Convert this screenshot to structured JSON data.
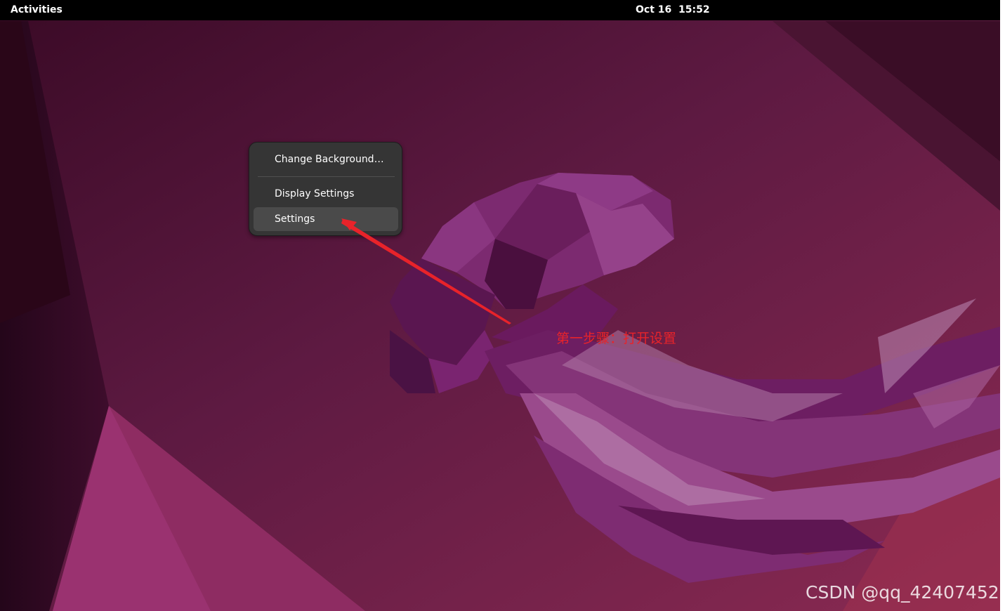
{
  "topbar": {
    "activities_label": "Activities",
    "clock": "Oct 16  15:52"
  },
  "context_menu": {
    "items": [
      {
        "label": "Change Background…"
      },
      {
        "label": "Display Settings"
      },
      {
        "label": "Settings",
        "highlighted": true
      }
    ]
  },
  "annotation": {
    "text": "第一步骤：打开设置",
    "color": "#e8232a"
  },
  "watermark": {
    "text": "CSDN @qq_42407452"
  },
  "colors": {
    "wallpaper_base": "#5c1a3e",
    "wallpaper_dark": "#2a0a1c",
    "jellyfish": "#8a2f78",
    "topbar": "#000000",
    "menu_background": "#353535",
    "menu_highlight": "#4a4a4a"
  }
}
